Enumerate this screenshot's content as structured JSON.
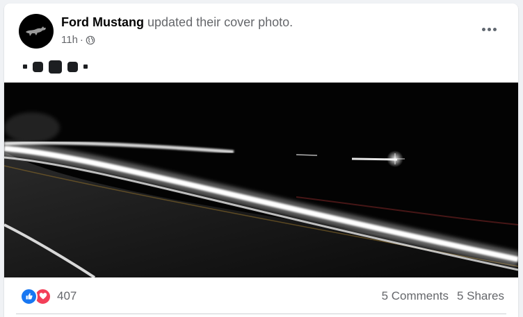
{
  "post": {
    "author": "Ford Mustang",
    "action": "updated their cover photo.",
    "time": "11h",
    "privacy_icon": "globe-icon",
    "more_icon": "more-options-icon",
    "caption_icons": [
      "small-square",
      "square",
      "large-square",
      "square",
      "small-square"
    ]
  },
  "reactions": {
    "icons": [
      "like-icon",
      "love-icon"
    ],
    "count": "407"
  },
  "stats": {
    "comments": "5 Comments",
    "shares": "5 Shares"
  },
  "colors": {
    "like": "#1877f2",
    "love": "#f33e58",
    "text_secondary": "#65676b",
    "text_primary": "#050505"
  }
}
